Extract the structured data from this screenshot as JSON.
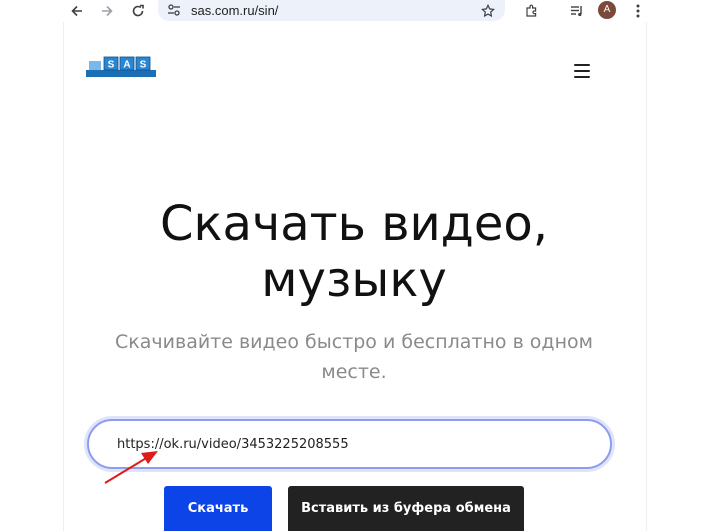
{
  "browser": {
    "url": "sas.com.ru/sin/",
    "avatar_letter": "A"
  },
  "site": {
    "logo_text": "SAS",
    "hero_title_line1": "Скачать видео,",
    "hero_title_line2": "музыку",
    "hero_subtitle_line1": "Скачивайте видео быстро и бесплатно в одном",
    "hero_subtitle_line2": "месте.",
    "input_value": "https://ok.ru/video/3453225208555",
    "download_label": "Скачать",
    "paste_label": "Вставить из буфера обмена"
  },
  "colors": {
    "primary_button": "#0d44e8",
    "secondary_button": "#222222",
    "input_border": "#8d9cf0",
    "annotation_arrow": "#e01b1b",
    "logo_blue": "#1b6fb6"
  }
}
